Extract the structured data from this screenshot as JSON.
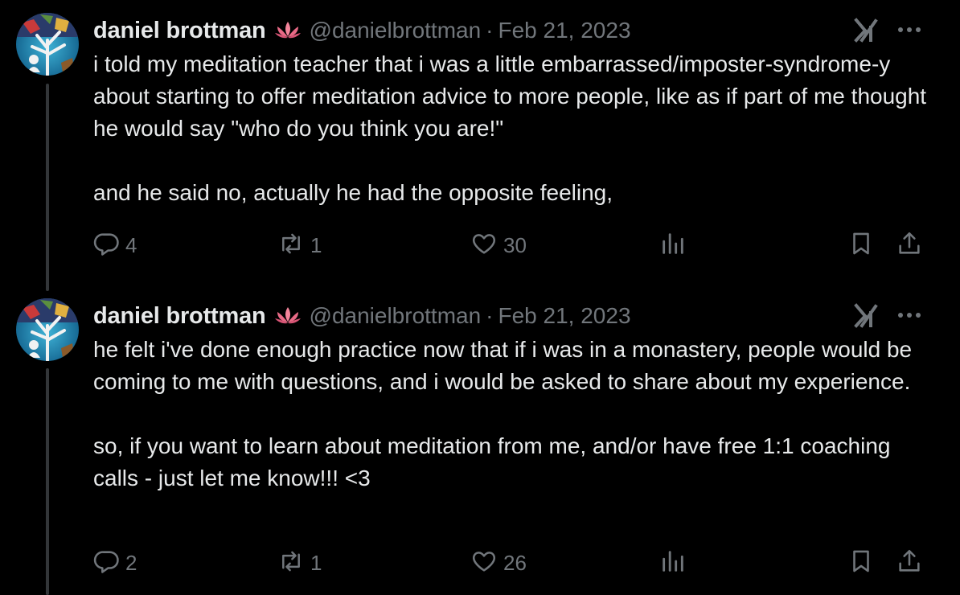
{
  "tweets": [
    {
      "author": {
        "name": "daniel brottman",
        "emoji": "lotus",
        "handle": "@danielbrottman"
      },
      "separator": "·",
      "date": "Feb 21, 2023",
      "paragraphs": [
        "i told my meditation teacher that i was a little embarrassed/imposter-syndrome-y about starting to offer meditation advice to more people, like as if part of me thought he would say \"who do you think you are!\"",
        "and he said no, actually he had the opposite feeling,"
      ],
      "stats": {
        "replies": "4",
        "reposts": "1",
        "likes": "30"
      }
    },
    {
      "author": {
        "name": "daniel brottman",
        "emoji": "lotus",
        "handle": "@danielbrottman"
      },
      "separator": "·",
      "date": "Feb 21, 2023",
      "paragraphs": [
        "he felt i've done enough practice now that if i was in a monastery, people would be coming to me with questions, and i would be asked to share about my experience.",
        "so, if you want to learn about meditation from me, and/or have free 1:1 coaching calls - just let me know!!! <3"
      ],
      "stats": {
        "replies": "2",
        "reposts": "1",
        "likes": "26"
      }
    }
  ],
  "icons": {
    "reply": "reply-icon",
    "repost": "repost-icon",
    "like": "heart-icon",
    "views": "views-icon",
    "bookmark": "bookmark-icon",
    "share": "share-icon",
    "grok": "grok-icon",
    "more": "more-icon"
  },
  "colors": {
    "background": "#000000",
    "text_primary": "#e7e9ea",
    "text_secondary": "#71767b",
    "thread_line": "#333639",
    "lotus": "#f4859b"
  }
}
